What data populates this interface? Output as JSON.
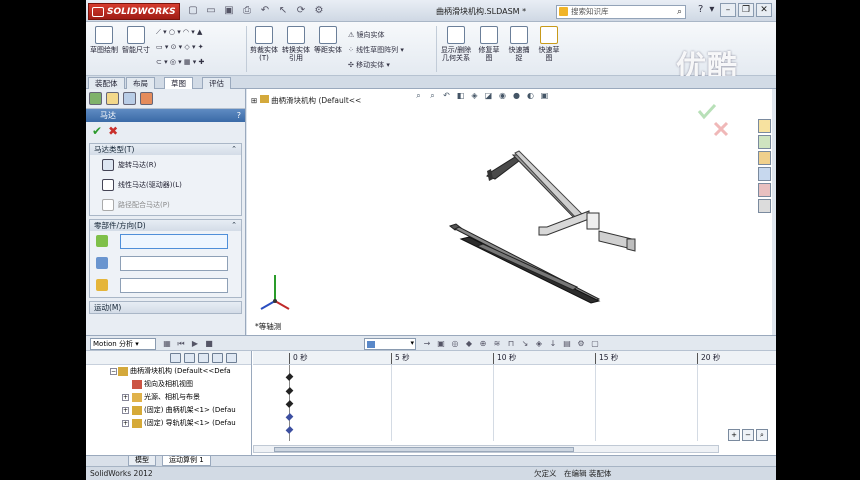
{
  "app": {
    "logo": "SOLIDWORKS",
    "document_title": "曲柄滑块机构.SLDASM *",
    "search_placeholder": "搜索知识库",
    "watermark": "优酷"
  },
  "ribbon": {
    "sketch": "草图绘制",
    "smart_dim": "智能尺寸",
    "trim": "剪裁实体(T)",
    "convert": "转换实体引用",
    "offset": "等距实体",
    "mirror": "镜向实体",
    "linear_pattern": "线性草图阵列",
    "move": "移动实体",
    "display_relations": "显示/删除几何关系",
    "repair": "修复草图",
    "quick_snaps": "快速捕捉",
    "rapid_sketch": "快速草图"
  },
  "tabs": [
    "装配体",
    "布局",
    "草图",
    "评估"
  ],
  "active_tab": 2,
  "property_manager": {
    "title": "马达",
    "motor_type_header": "马达类型(T)",
    "rotary_motor": "旋转马达(R)",
    "linear_motor": "线性马达(驱动器)(L)",
    "path_mate_motor": "路径配合马达(P)",
    "component_direction_header": "零部件/方向(D)",
    "motion_header": "运动(M)"
  },
  "viewport": {
    "tree_label": "曲柄滑块机构  (Default<<",
    "view_name": "*等轴测"
  },
  "motion_study": {
    "type": "Motion 分析",
    "ticks": [
      "0 秒",
      "5 秒",
      "10 秒",
      "15 秒",
      "20 秒"
    ],
    "rows": [
      "曲柄滑块机构  (Default<<Defa",
      "视向及相机视图",
      "光源、相机与布景",
      "(固定) 曲柄机架<1> (Defau",
      "(固定) 导轨机架<1> (Defau"
    ]
  },
  "bottom_tabs": [
    "模型",
    "运动算例 1"
  ],
  "status": {
    "app": "SolidWorks 2012",
    "state": "欠定义",
    "mode": "在编辑 装配体"
  }
}
